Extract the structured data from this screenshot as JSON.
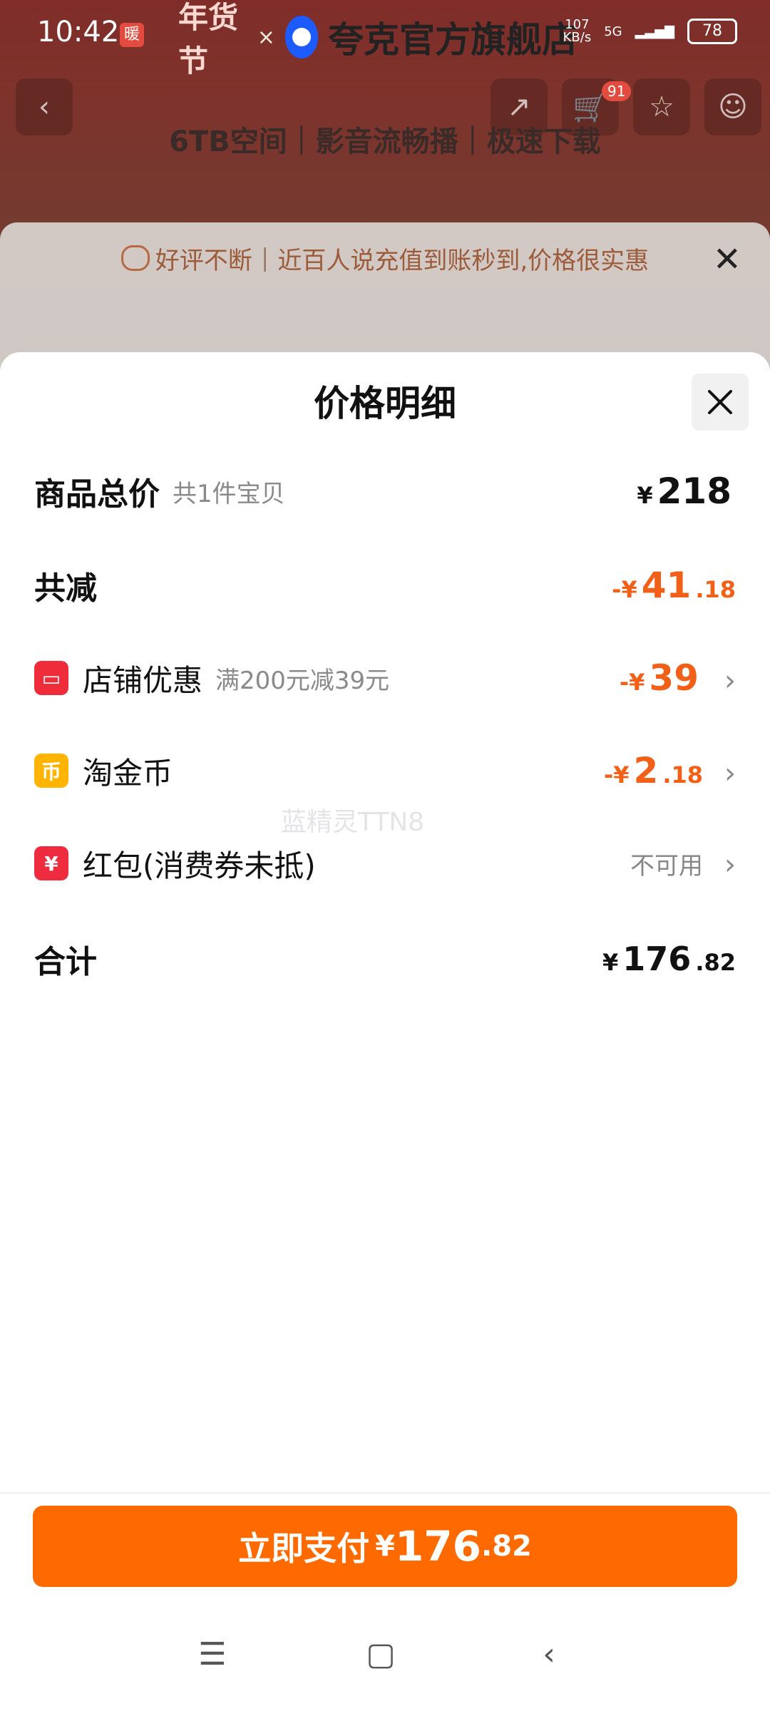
{
  "status_bar": {
    "time": "10:42",
    "badge": "暖",
    "net_speed_value": "107",
    "net_speed_unit": "KB/s",
    "signal": "5G",
    "battery": "78"
  },
  "store_banner": {
    "festival": "年货节",
    "separator": "×",
    "store_name": "夸克官方旗舰店"
  },
  "nav": {
    "cart_count": "91"
  },
  "product_headline": "6TB空间｜影音流畅播｜极速下载",
  "notice": {
    "text_highlight": "好评不断",
    "text_rest": "近百人说充值到账秒到,价格很实惠"
  },
  "sheet": {
    "title": "价格明细",
    "rows": [
      {
        "label": "商品总价",
        "sub": "共1件宝贝",
        "yen": "¥",
        "int": "218",
        "dec": ""
      },
      {
        "label": "共减",
        "yen": "-¥",
        "int": "41",
        "dec": ".18"
      },
      {
        "label": "店铺优惠",
        "sub": "满200元减39元",
        "yen": "-¥",
        "int": "39",
        "dec": "",
        "icon": "store-icon"
      },
      {
        "label": "淘金币",
        "yen": "-¥",
        "int": "2",
        "dec": ".18",
        "icon": "coin-icon"
      },
      {
        "label": "红包(消费券未抵)",
        "status": "不可用",
        "icon": "red-packet-icon"
      },
      {
        "label": "合计",
        "yen": "¥",
        "int": "176",
        "dec": ".82"
      }
    ],
    "watermark": "蓝精灵TTN8"
  },
  "pay": {
    "label": "立即支付",
    "yen": "¥",
    "int": "176",
    "dec": ".82"
  },
  "colors": {
    "accent": "#ff6a00",
    "discount": "#f25f16"
  }
}
